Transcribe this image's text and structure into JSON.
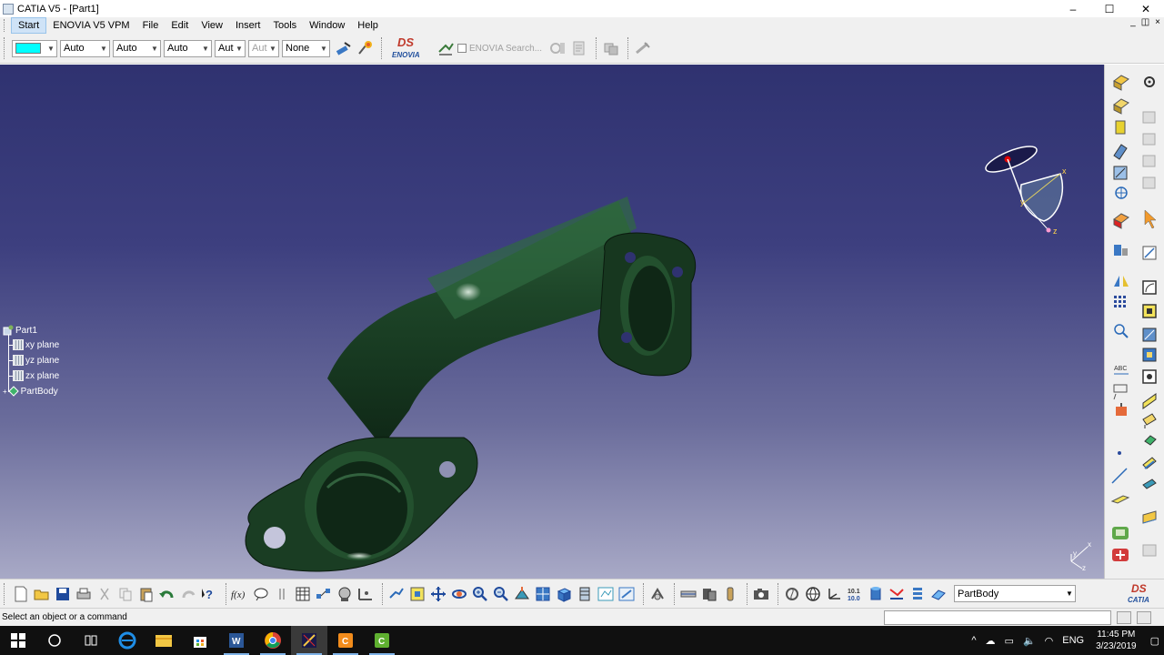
{
  "window": {
    "title": "CATIA V5 - [Part1]",
    "buttons": {
      "minimize": "–",
      "maximize": "☐",
      "close": "✕"
    },
    "mdi_buttons": {
      "minimize": "_",
      "restore": "◫",
      "close": "×"
    }
  },
  "menu": {
    "items": [
      "Start",
      "ENOVIA V5 VPM",
      "File",
      "Edit",
      "View",
      "Insert",
      "Tools",
      "Window",
      "Help"
    ]
  },
  "toolbar_top": {
    "color_swatch": "#00ffff",
    "combos": [
      "Auto",
      "Auto",
      "Auto",
      "Aut",
      "Aut",
      "None"
    ],
    "enovia_logo_ds": "DS",
    "enovia_logo_label": "ENOVIA",
    "enovia_search": "ENOVIA Search..."
  },
  "tree": {
    "root": "Part1",
    "children": [
      "xy plane",
      "yz plane",
      "zx plane",
      "PartBody"
    ]
  },
  "compass_axes": {
    "x": "x",
    "y": "y",
    "z": "z"
  },
  "corner_axes": {
    "x": "x",
    "y": "y",
    "z": "z"
  },
  "bottom_toolbar": {
    "current_body": "PartBody",
    "catia_logo_ds": "DS",
    "catia_logo_label": "CATIA"
  },
  "status": {
    "text": "Select an object or a command"
  },
  "taskbar": {
    "time": "11:45 PM",
    "date": "3/23/2019",
    "language": "ENG"
  },
  "colors": {
    "viewport_top": "#2f3270",
    "viewport_bottom": "#a8a9c6",
    "part": "#1f4a2a",
    "accent": "#0078d7"
  }
}
